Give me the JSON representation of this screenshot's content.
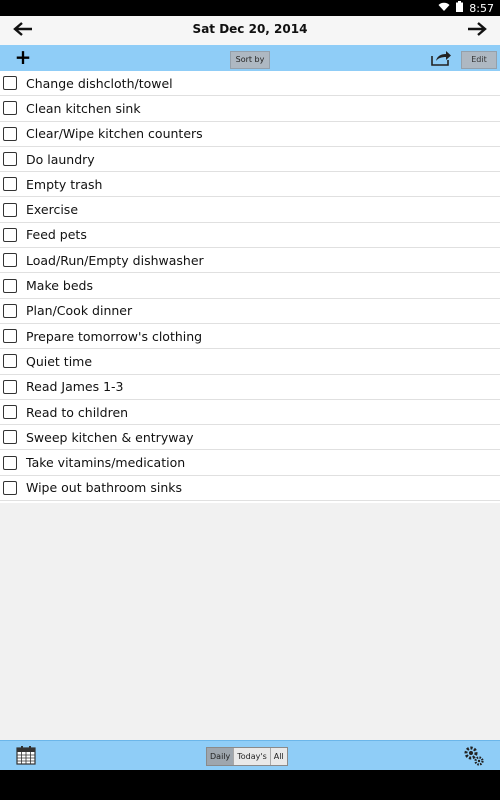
{
  "status": {
    "time": "8:57"
  },
  "header": {
    "date": "Sat Dec 20, 2014"
  },
  "toolbar": {
    "sort_label": "Sort by",
    "edit_label": "Edit"
  },
  "tasks": [
    "Change dishcloth/towel",
    "Clean kitchen sink",
    "Clear/Wipe kitchen counters",
    "Do laundry",
    "Empty trash",
    "Exercise",
    "Feed pets",
    "Load/Run/Empty dishwasher",
    "Make beds",
    "Plan/Cook dinner",
    "Prepare tomorrow's clothing",
    "Quiet time",
    "Read James 1-3",
    "Read to children",
    "Sweep kitchen & entryway",
    "Take vitamins/medication",
    "Wipe out bathroom sinks"
  ],
  "footer": {
    "tabs": [
      "Daily",
      "Today's",
      "All"
    ],
    "active_tab": "Daily"
  },
  "colors": {
    "accent": "#8fcdf7",
    "segment_active": "#9ea6ae"
  },
  "icons": {
    "prev": "arrow-left-icon",
    "next": "arrow-right-icon",
    "add": "plus-icon",
    "share": "share-icon",
    "calendar": "calendar-icon",
    "settings": "gear-icon",
    "wifi": "wifi-icon",
    "battery": "battery-icon"
  }
}
